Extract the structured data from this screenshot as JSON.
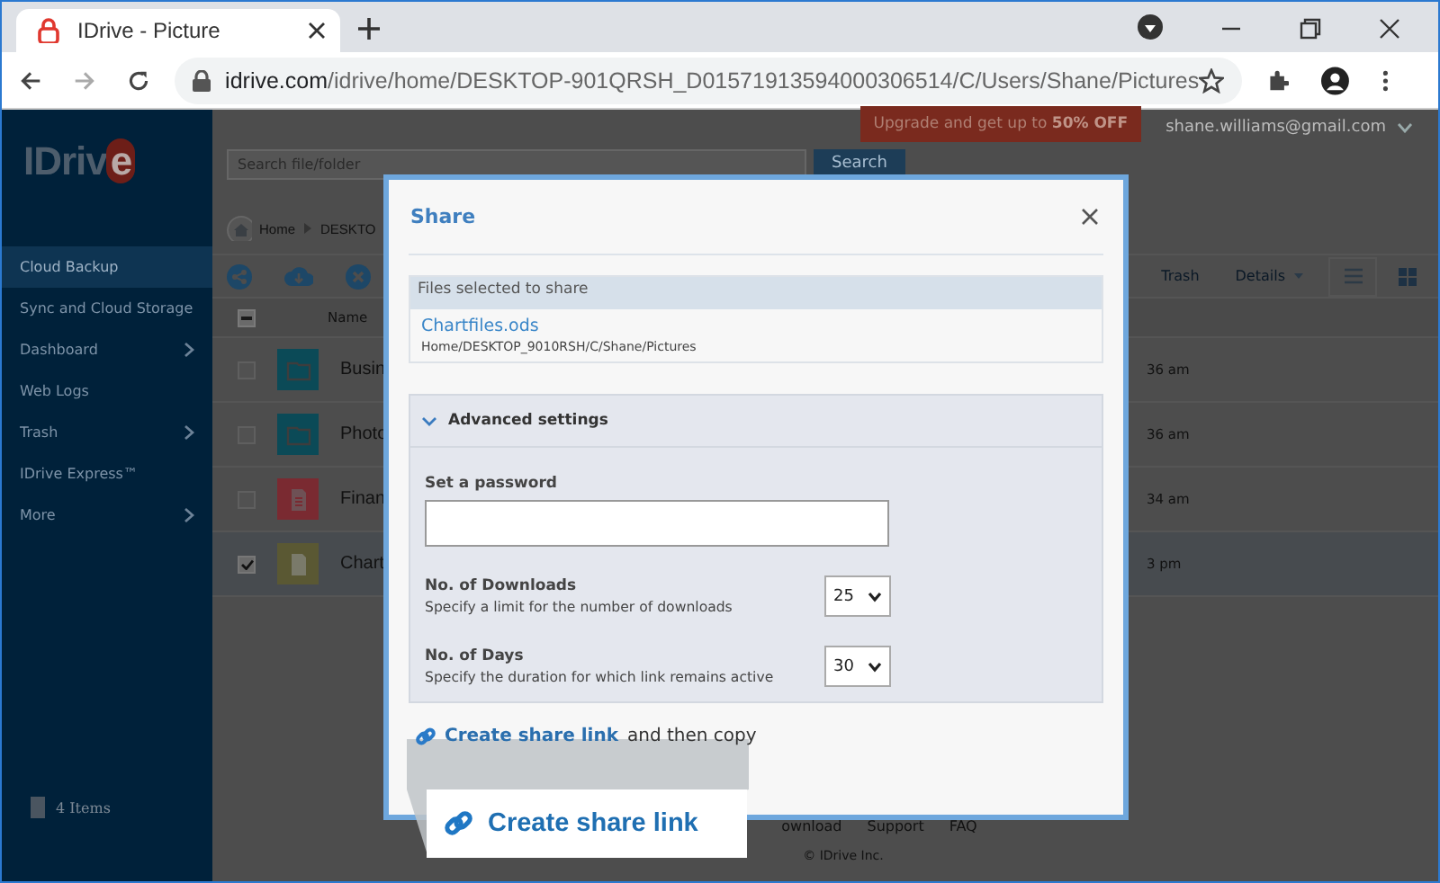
{
  "browser": {
    "tab": {
      "title": "IDrive - Picture"
    },
    "url": {
      "host": "idrive.com",
      "path": "/idrive/home/DESKTOP-901QRSH_D01571913594000306514/C/Users/Shane/Pictures"
    }
  },
  "app": {
    "logo": "IDrive",
    "upgrade": "Upgrade and get up to **50% OFF**",
    "account": "shane.williams@gmail.com",
    "search": {
      "placeholder": "Search file/folder",
      "button": "Search"
    },
    "breadcrumb": [
      "Home",
      "DESKTO"
    ],
    "sidebar": {
      "items": [
        {
          "label": "Cloud Backup",
          "selected": true,
          "chevron": false
        },
        {
          "label": "Sync and Cloud Storage",
          "selected": false,
          "chevron": false
        },
        {
          "label": "Dashboard",
          "selected": false,
          "chevron": true
        },
        {
          "label": "Web Logs",
          "selected": false,
          "chevron": false
        },
        {
          "label": "Trash",
          "selected": false,
          "chevron": true
        },
        {
          "label": "IDrive Express™",
          "selected": false,
          "chevron": false
        },
        {
          "label": "More",
          "selected": false,
          "chevron": true
        }
      ],
      "footer": "4 Items"
    },
    "toolbar": {
      "trash": "Trash",
      "details": "Details"
    },
    "table": {
      "column": "Name",
      "select_all": {
        "indeterminate": true
      },
      "rows": [
        {
          "name": "Busin",
          "kind": "folder",
          "color": "#0b4a57",
          "modified": "36 am",
          "checked": false
        },
        {
          "name": "Photo",
          "kind": "folder",
          "color": "#0b4a57",
          "modified": "36 am",
          "checked": false
        },
        {
          "name": "Finan",
          "kind": "document",
          "color": "#7a2a31",
          "modified": "34 am",
          "checked": false
        },
        {
          "name": "Chart",
          "kind": "file",
          "color": "#5a5833",
          "modified": "3 pm",
          "checked": true
        }
      ]
    },
    "footer": {
      "links": [
        "ownload",
        "Support",
        "FAQ"
      ],
      "copyright": "© IDrive Inc."
    }
  },
  "dialog": {
    "title": "Share",
    "files": {
      "heading": "Files selected to share",
      "items": [
        {
          "name": "Chartfiles.ods",
          "path": "Home/DESKTOP_9010RSH/C/Shane/Pictures"
        }
      ]
    },
    "advanced": {
      "title": "Advanced settings",
      "expanded": true,
      "password": {
        "label": "Set a password"
      },
      "options": [
        {
          "title": "No. of Downloads",
          "description": "Specify a limit for the number of downloads",
          "value": "25"
        },
        {
          "title": "No. of Days",
          "description": "Specify the duration for which link remains active",
          "value": "30"
        }
      ]
    },
    "create_link": {
      "link": "Create share link",
      "suffix": "and then copy"
    },
    "callout": {
      "label": "Create share link"
    }
  }
}
